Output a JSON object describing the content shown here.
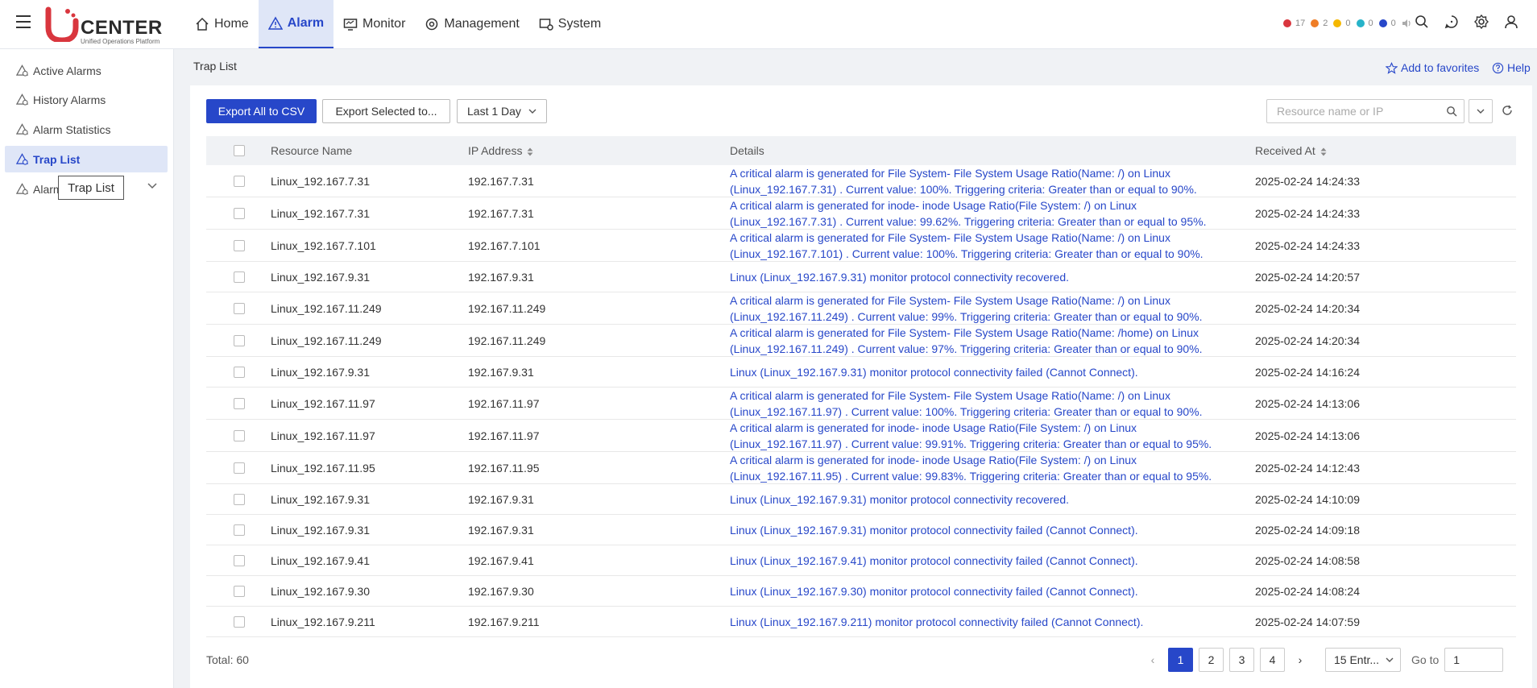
{
  "header": {
    "logo_text": "CENTER",
    "logo_sub": "Unified Operations Platform",
    "nav": [
      {
        "label": "Home",
        "icon": "home-icon"
      },
      {
        "label": "Alarm",
        "icon": "warning-icon"
      },
      {
        "label": "Monitor",
        "icon": "monitor-icon"
      },
      {
        "label": "Management",
        "icon": "management-icon"
      },
      {
        "label": "System",
        "icon": "system-icon"
      }
    ],
    "active_nav": "Alarm",
    "status_counts": [
      {
        "value": "17",
        "color": "#d9363e"
      },
      {
        "value": "2",
        "color": "#ef7d26"
      },
      {
        "value": "0",
        "color": "#f5b800"
      },
      {
        "value": "0",
        "color": "#27b3c9"
      },
      {
        "value": "0",
        "color": "#2747c9"
      }
    ],
    "icons": [
      "sound-icon",
      "search-icon",
      "chat-icon",
      "settings-icon",
      "user-icon"
    ]
  },
  "sidebar": {
    "items": [
      {
        "label": "Active Alarms"
      },
      {
        "label": "History Alarms"
      },
      {
        "label": "Alarm Statistics"
      },
      {
        "label": "Trap List"
      },
      {
        "label": "Alarm"
      }
    ],
    "active": "Trap List",
    "tooltip": "Trap List"
  },
  "page": {
    "title": "Trap List",
    "favorites": "Add to favorites",
    "help": "Help"
  },
  "toolbar": {
    "export_all": "Export All to CSV",
    "export_selected": "Export Selected to...",
    "time_range": "Last 1 Day",
    "search_placeholder": "Resource name or IP"
  },
  "table": {
    "columns": {
      "name": "Resource Name",
      "ip": "IP Address",
      "details": "Details",
      "time": "Received At"
    },
    "rows": [
      {
        "name": "Linux_192.167.7.31",
        "ip": "192.167.7.31",
        "details": [
          "A  critical alarm is generated for File System- File System Usage Ratio(Name: /) on Linux",
          "(Linux_192.167.7.31) . Current value: 100%. Triggering criteria:  Greater than or equal to 90%."
        ],
        "time": "2025-02-24 14:24:33"
      },
      {
        "name": "Linux_192.167.7.31",
        "ip": "192.167.7.31",
        "details": [
          "A  critical alarm is generated for inode- inode Usage Ratio(File System: /) on Linux",
          "(Linux_192.167.7.31) . Current value: 99.62%. Triggering criteria:  Greater than or equal to 95%."
        ],
        "time": "2025-02-24 14:24:33"
      },
      {
        "name": "Linux_192.167.7.101",
        "ip": "192.167.7.101",
        "details": [
          "A  critical alarm is generated for File System- File System Usage Ratio(Name: /) on Linux",
          "(Linux_192.167.7.101) . Current value: 100%. Triggering criteria:  Greater than or equal to 90%."
        ],
        "time": "2025-02-24 14:24:33"
      },
      {
        "name": "Linux_192.167.9.31",
        "ip": "192.167.9.31",
        "details": [
          "Linux (Linux_192.167.9.31) monitor protocol connectivity recovered."
        ],
        "time": "2025-02-24 14:20:57"
      },
      {
        "name": "Linux_192.167.11.249",
        "ip": "192.167.11.249",
        "details": [
          "A  critical alarm is generated for File System- File System Usage Ratio(Name: /) on Linux",
          "(Linux_192.167.11.249) . Current value: 99%. Triggering criteria:  Greater than or equal to 90%."
        ],
        "time": "2025-02-24 14:20:34"
      },
      {
        "name": "Linux_192.167.11.249",
        "ip": "192.167.11.249",
        "details": [
          "A  critical alarm is generated for File System- File System Usage Ratio(Name: /home) on Linux",
          "(Linux_192.167.11.249) . Current value: 97%. Triggering criteria:  Greater than or equal to 90%."
        ],
        "time": "2025-02-24 14:20:34"
      },
      {
        "name": "Linux_192.167.9.31",
        "ip": "192.167.9.31",
        "details": [
          "Linux (Linux_192.167.9.31) monitor protocol connectivity failed (Cannot Connect)."
        ],
        "time": "2025-02-24 14:16:24"
      },
      {
        "name": "Linux_192.167.11.97",
        "ip": "192.167.11.97",
        "details": [
          "A  critical alarm is generated for File System- File System Usage Ratio(Name: /) on Linux",
          "(Linux_192.167.11.97) . Current value: 100%. Triggering criteria:  Greater than or equal to 90%."
        ],
        "time": "2025-02-24 14:13:06"
      },
      {
        "name": "Linux_192.167.11.97",
        "ip": "192.167.11.97",
        "details": [
          "A  critical alarm is generated for inode- inode Usage Ratio(File System: /) on Linux",
          "(Linux_192.167.11.97) . Current value: 99.91%. Triggering criteria:  Greater than or equal to 95%."
        ],
        "time": "2025-02-24 14:13:06"
      },
      {
        "name": "Linux_192.167.11.95",
        "ip": "192.167.11.95",
        "details": [
          "A  critical alarm is generated for inode- inode Usage Ratio(File System: /) on Linux",
          "(Linux_192.167.11.95) . Current value: 99.83%. Triggering criteria:  Greater than or equal to 95%."
        ],
        "time": "2025-02-24 14:12:43"
      },
      {
        "name": "Linux_192.167.9.31",
        "ip": "192.167.9.31",
        "details": [
          "Linux (Linux_192.167.9.31) monitor protocol connectivity recovered."
        ],
        "time": "2025-02-24 14:10:09"
      },
      {
        "name": "Linux_192.167.9.31",
        "ip": "192.167.9.31",
        "details": [
          "Linux (Linux_192.167.9.31) monitor protocol connectivity failed (Cannot Connect)."
        ],
        "time": "2025-02-24 14:09:18"
      },
      {
        "name": "Linux_192.167.9.41",
        "ip": "192.167.9.41",
        "details": [
          "Linux (Linux_192.167.9.41) monitor protocol connectivity failed (Cannot Connect)."
        ],
        "time": "2025-02-24 14:08:58"
      },
      {
        "name": "Linux_192.167.9.30",
        "ip": "192.167.9.30",
        "details": [
          "Linux (Linux_192.167.9.30) monitor protocol connectivity failed (Cannot Connect)."
        ],
        "time": "2025-02-24 14:08:24"
      },
      {
        "name": "Linux_192.167.9.211",
        "ip": "192.167.9.211",
        "details": [
          "Linux (Linux_192.167.9.211) monitor protocol connectivity failed (Cannot Connect)."
        ],
        "time": "2025-02-24 14:07:59"
      }
    ]
  },
  "footer": {
    "total": "Total: 60",
    "pages": [
      "1",
      "2",
      "3",
      "4"
    ],
    "current_page": "1",
    "entries": "15 Entr...",
    "goto_label": "Go to",
    "goto_value": "1"
  }
}
